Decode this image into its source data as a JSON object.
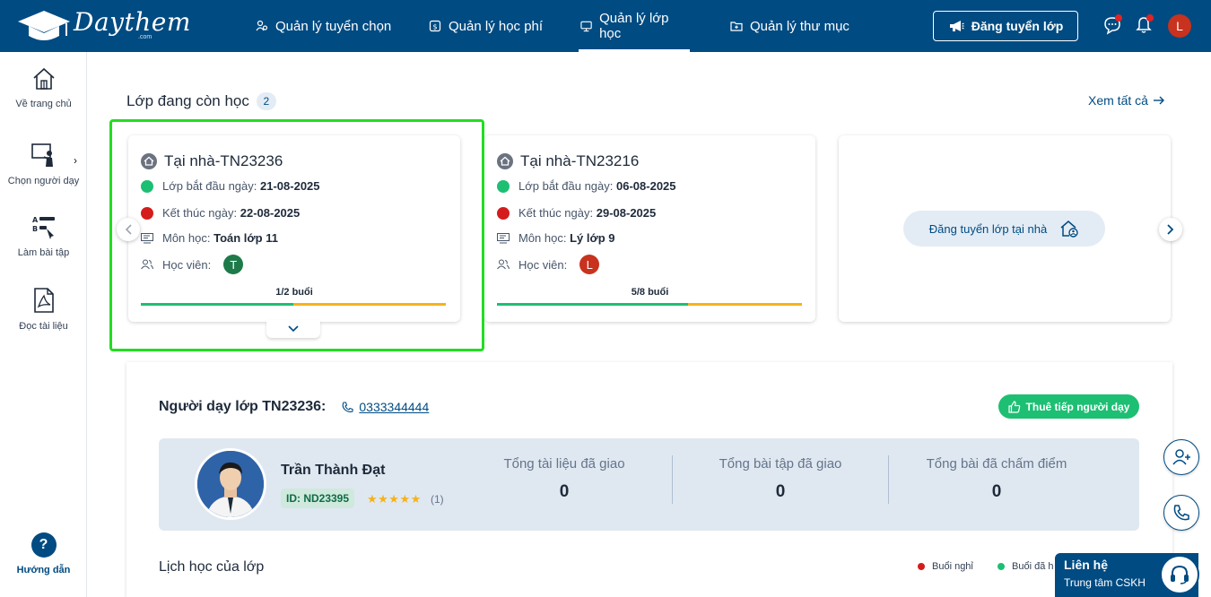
{
  "brand": {
    "name": "Daythem",
    "suffix": ".com"
  },
  "nav": {
    "items": [
      {
        "label": "Quản lý tuyển chọn"
      },
      {
        "label": "Quản lý học phí"
      },
      {
        "label": "Quản lý lớp học",
        "active": true
      },
      {
        "label": "Quản lý thư mục"
      }
    ],
    "post_button": "Đăng tuyển lớp",
    "user_initial": "L"
  },
  "sidebar": {
    "items": [
      {
        "label": "Về trang chủ",
        "icon": "home-icon"
      },
      {
        "label": "Chọn người dạy",
        "icon": "teacher-board-icon"
      },
      {
        "label": "Làm bài tập",
        "icon": "exercise-icon"
      },
      {
        "label": "Đọc tài liệu",
        "icon": "pdf-document-icon"
      }
    ],
    "help": {
      "label": "Hướng dẫn",
      "icon_text": "?"
    }
  },
  "active_classes": {
    "title": "Lớp đang còn học",
    "count": "2",
    "see_all": "Xem tất cả",
    "cards": [
      {
        "title": "Tại nhà-TN23236",
        "start_label": "Lớp bắt đầu ngày:",
        "start_date": "21-08-2025",
        "end_label": "Kết thúc ngày:",
        "end_date": "22-08-2025",
        "subject_label": "Môn học:",
        "subject": "Toán lớp 11",
        "students_label": "Học viên:",
        "student_initial": "T",
        "student_color": "#1e7a4a",
        "progress_label": "1/2 buổi",
        "progress": 0.5
      },
      {
        "title": "Tại nhà-TN23216",
        "start_label": "Lớp bắt đầu ngày:",
        "start_date": "06-08-2025",
        "end_label": "Kết thúc ngày:",
        "end_date": "29-08-2025",
        "subject_label": "Môn học:",
        "subject": "Lý lớp 9",
        "students_label": "Học viên:",
        "student_initial": "L",
        "student_color": "#c8321e",
        "progress_label": "5/8 buổi",
        "progress": 0.625
      }
    ],
    "post_home_class": "Đăng tuyển lớp tại nhà"
  },
  "teacher_panel": {
    "heading": "Người dạy lớp TN23236:",
    "phone": "0333344444",
    "rehire_button": "Thuê tiếp người dạy",
    "name": "Trần Thành Đạt",
    "id": "ID: ND23395",
    "stars": "★★★★★",
    "rating_count": "(1)",
    "stats": [
      {
        "label": "Tổng tài liệu đã giao",
        "value": "0"
      },
      {
        "label": "Tổng bài tập đã giao",
        "value": "0"
      },
      {
        "label": "Tổng bài đã chấm điểm",
        "value": "0"
      }
    ],
    "schedule_title": "Lịch học của lớp",
    "legend": [
      {
        "label": "Buổi nghỉ",
        "color": "#d41c1c"
      },
      {
        "label": "Buổi đã h",
        "color": "#1dbf73"
      }
    ]
  },
  "contact": {
    "title": "Liên hệ",
    "subtitle": "Trung tâm CSKH"
  },
  "colors": {
    "primary": "#004b82",
    "green": "#1dbf73",
    "orange": "#f6b21b",
    "red": "#d41c1c",
    "highlight": "#22dd22"
  }
}
